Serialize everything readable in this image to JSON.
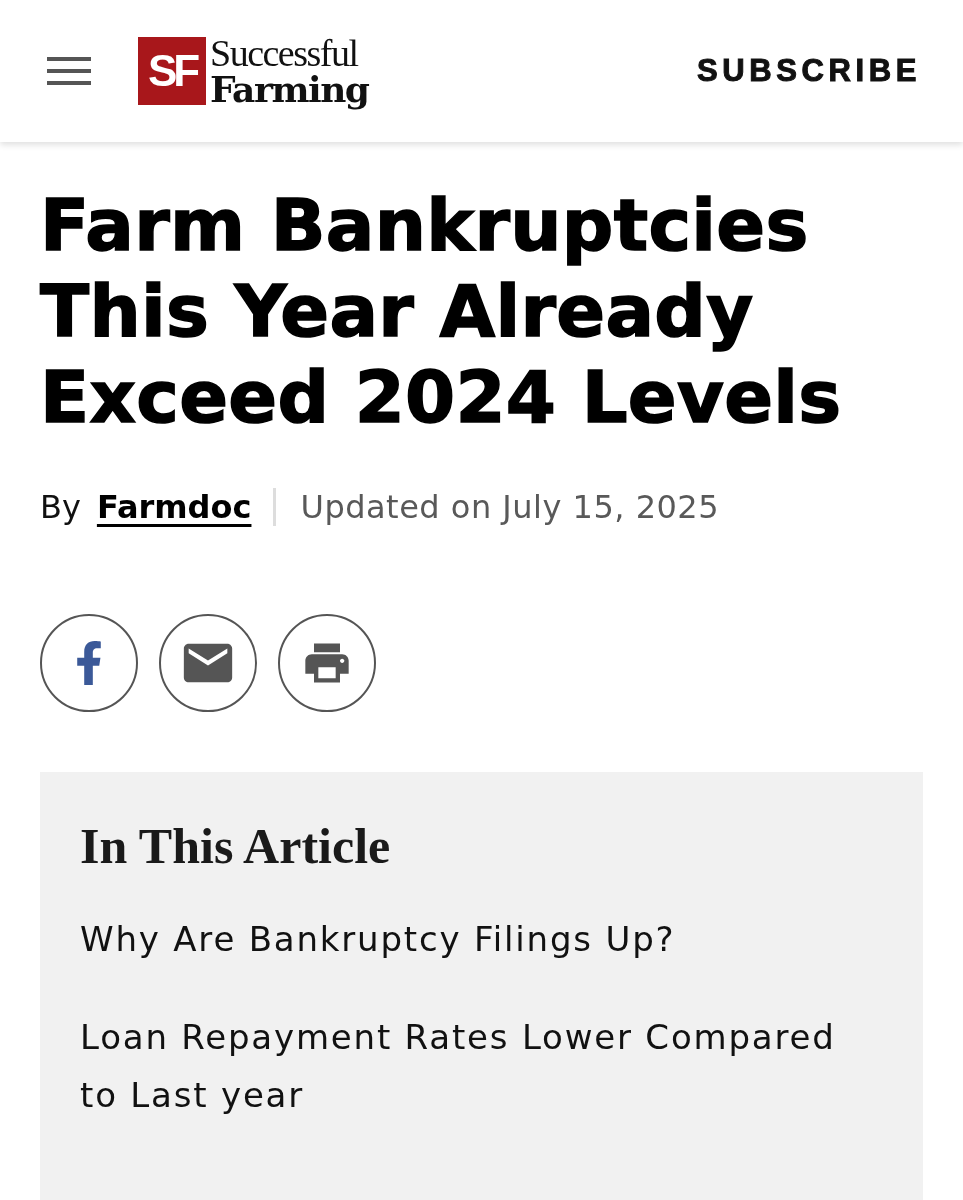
{
  "header": {
    "logo": {
      "mark": "SF",
      "line_1": "Successful",
      "line_2": "Farming"
    },
    "subscribe": "SUBSCRIBE"
  },
  "article": {
    "title": "Farm Bankruptcies This Year Already Exceed 2024 Levels",
    "byline": {
      "prefix": "By",
      "author": "Farmdoc",
      "updated": "Updated on July 15, 2025"
    },
    "share_buttons": [
      {
        "kind": "facebook"
      },
      {
        "kind": "email"
      },
      {
        "kind": "print"
      }
    ]
  },
  "toc": {
    "heading": "In This Article",
    "items": [
      "Why Are Bankruptcy Filings Up?",
      "Loan Repayment Rates Lower Compared to Last year"
    ]
  }
}
